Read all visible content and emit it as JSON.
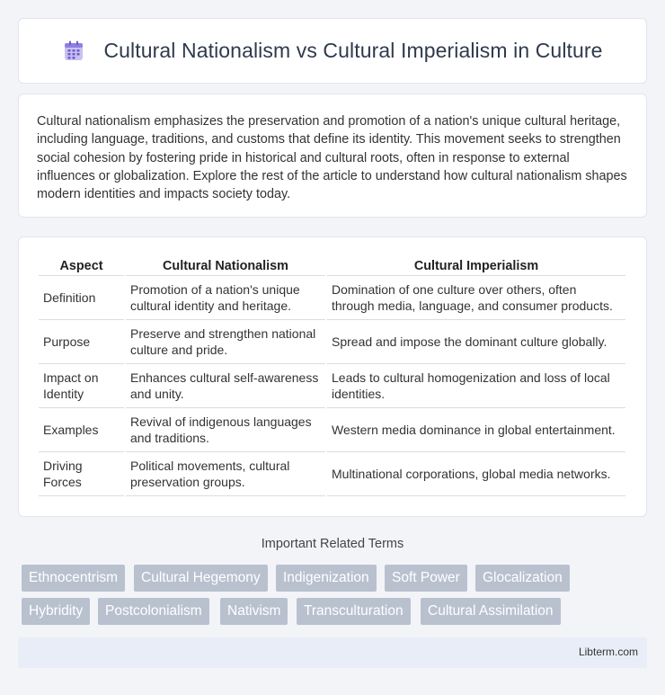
{
  "header": {
    "title": "Cultural Nationalism vs Cultural Imperialism in Culture",
    "icon": "document-grid-icon"
  },
  "intro": {
    "text": "Cultural nationalism emphasizes the preservation and promotion of a nation's unique cultural heritage, including language, traditions, and customs that define its identity. This movement seeks to strengthen social cohesion by fostering pride in historical and cultural roots, often in response to external influences or globalization. Explore the rest of the article to understand how cultural nationalism shapes modern identities and impacts society today."
  },
  "table": {
    "headers": [
      "Aspect",
      "Cultural Nationalism",
      "Cultural Imperialism"
    ],
    "rows": [
      [
        "Definition",
        "Promotion of a nation's unique cultural identity and heritage.",
        "Domination of one culture over others, often through media, language, and consumer products."
      ],
      [
        "Purpose",
        "Preserve and strengthen national culture and pride.",
        "Spread and impose the dominant culture globally."
      ],
      [
        "Impact on Identity",
        "Enhances cultural self-awareness and unity.",
        "Leads to cultural homogenization and loss of local identities."
      ],
      [
        "Examples",
        "Revival of indigenous languages and traditions.",
        "Western media dominance in global entertainment."
      ],
      [
        "Driving Forces",
        "Political movements, cultural preservation groups.",
        "Multinational corporations, global media networks."
      ]
    ]
  },
  "related": {
    "title": "Important Related Terms",
    "terms": [
      "Ethnocentrism",
      "Cultural Hegemony",
      "Indigenization",
      "Soft Power",
      "Glocalization",
      "Hybridity",
      "Postcolonialism",
      "Nativism",
      "Transculturation",
      "Cultural Assimilation"
    ]
  },
  "footer": {
    "site": "Libterm.com"
  },
  "colors": {
    "tag_bg": "#b9c1cf",
    "page_bg": "#f3f4f8",
    "footer_bg": "#e8edf7"
  }
}
